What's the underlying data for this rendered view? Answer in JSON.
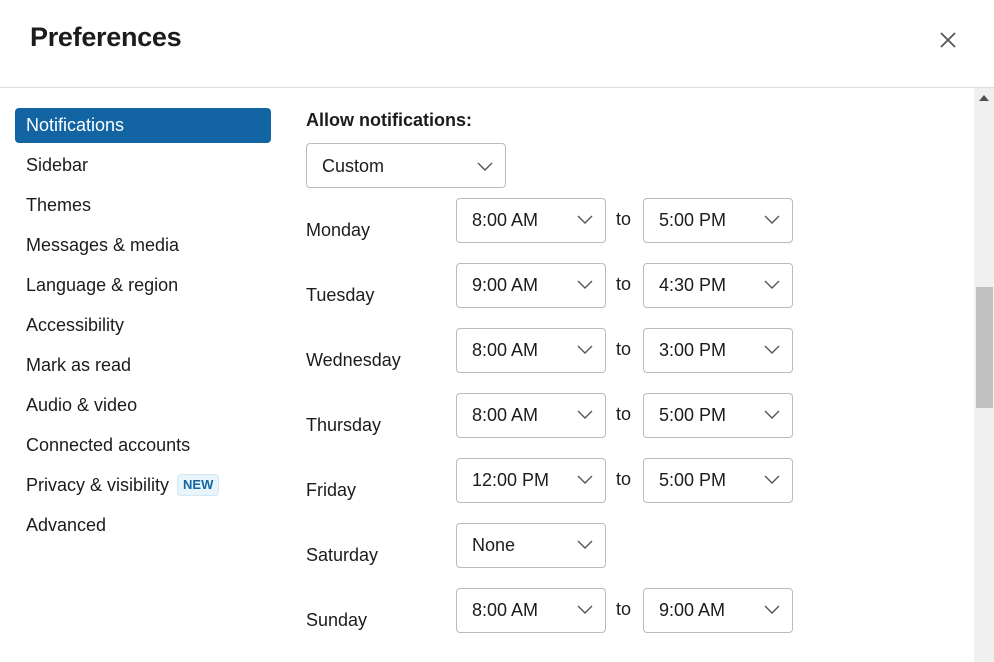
{
  "header": {
    "title": "Preferences",
    "close_icon": "close-icon"
  },
  "sidebar": {
    "items": [
      {
        "label": "Notifications",
        "active": true
      },
      {
        "label": "Sidebar"
      },
      {
        "label": "Themes"
      },
      {
        "label": "Messages & media"
      },
      {
        "label": "Language & region"
      },
      {
        "label": "Accessibility"
      },
      {
        "label": "Mark as read"
      },
      {
        "label": "Audio & video"
      },
      {
        "label": "Connected accounts"
      },
      {
        "label": "Privacy & visibility",
        "badge": "NEW"
      },
      {
        "label": "Advanced"
      }
    ]
  },
  "notifications": {
    "allow_label": "Allow notifications:",
    "allow_value": "Custom",
    "to_label": "to",
    "days": [
      {
        "day": "Monday",
        "from": "8:00 AM",
        "to": "5:00 PM"
      },
      {
        "day": "Tuesday",
        "from": "9:00 AM",
        "to": "4:30 PM"
      },
      {
        "day": "Wednesday",
        "from": "8:00 AM",
        "to": "3:00 PM"
      },
      {
        "day": "Thursday",
        "from": "8:00 AM",
        "to": "5:00 PM"
      },
      {
        "day": "Friday",
        "from": "12:00 PM",
        "to": "5:00 PM"
      },
      {
        "day": "Saturday",
        "from": "None",
        "to": null
      },
      {
        "day": "Sunday",
        "from": "8:00 AM",
        "to": "9:00 AM"
      }
    ]
  },
  "colors": {
    "accent": "#1264a3",
    "badge_bg": "#e8f5fa"
  }
}
